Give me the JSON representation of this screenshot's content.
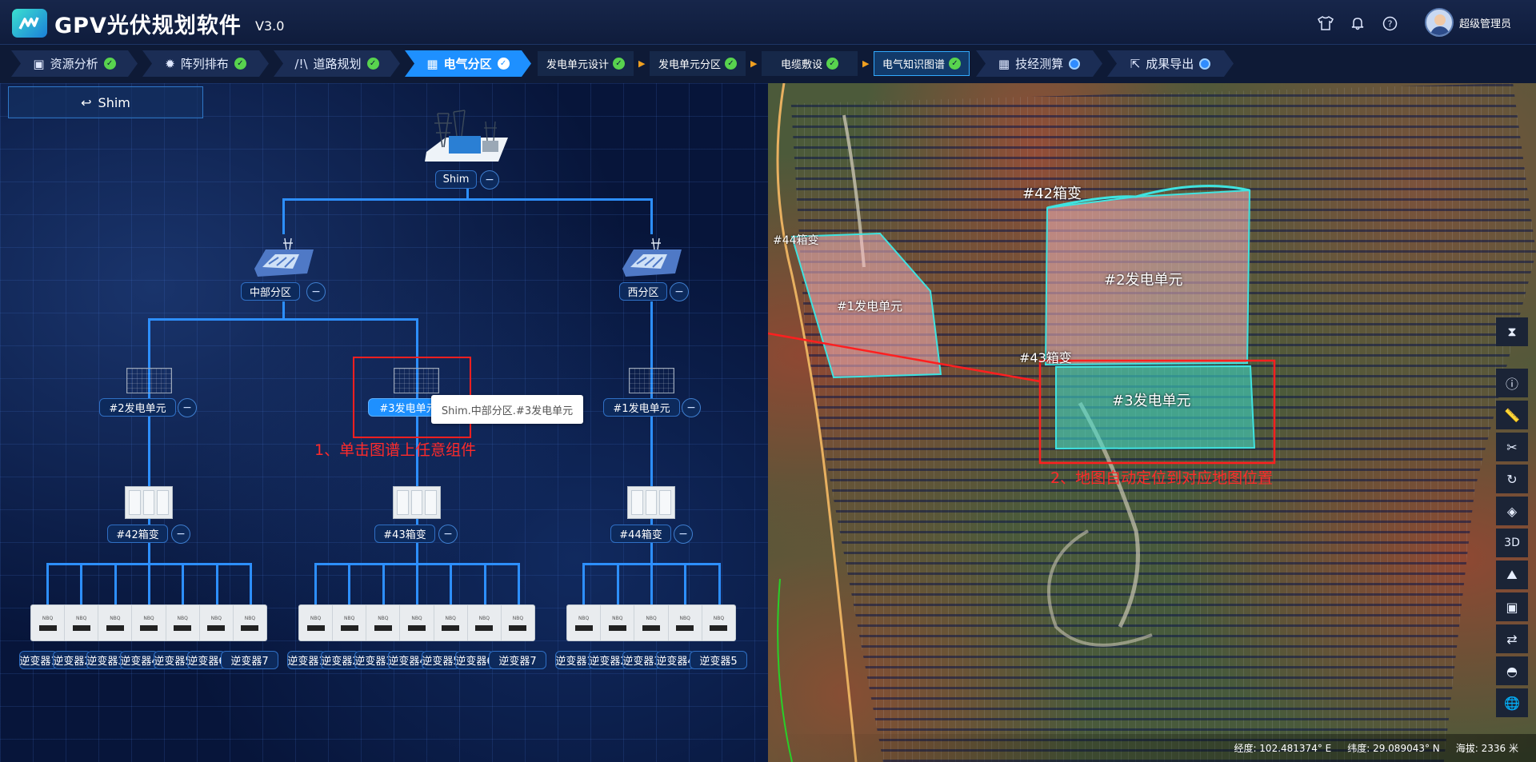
{
  "app": {
    "title": "GPV光伏规划软件",
    "version": "V3.0"
  },
  "header": {
    "user_name": "超级管理员",
    "icons": [
      "shirt-icon",
      "bell-icon",
      "help-icon"
    ]
  },
  "steps": [
    {
      "label": "资源分析",
      "status": "done",
      "icon": "resource-icon"
    },
    {
      "label": "阵列排布",
      "status": "done",
      "icon": "array-icon"
    },
    {
      "label": "道路规划",
      "status": "done",
      "icon": "road-icon"
    },
    {
      "label": "电气分区",
      "status": "active",
      "icon": "electric-icon"
    },
    {
      "label": "发电单元设计",
      "status": "done"
    },
    {
      "label": "发电单元分区",
      "status": "done"
    },
    {
      "label": "电缆敷设",
      "status": "done"
    },
    {
      "label": "电气知识图谱",
      "status": "current"
    },
    {
      "label": "技经测算",
      "status": "pending",
      "icon": "calc-icon"
    },
    {
      "label": "成果导出",
      "status": "pending",
      "icon": "export-icon"
    }
  ],
  "graph": {
    "back_button": "Shim",
    "root": "Shim",
    "zones": [
      "中部分区",
      "西分区"
    ],
    "units": [
      "#2发电单元",
      "#3发电单元",
      "#1发电单元"
    ],
    "boxes": [
      "#42箱变",
      "#43箱变",
      "#44箱变"
    ],
    "inverter_groups": [
      [
        "逆变器1",
        "逆变器2",
        "逆变器3",
        "逆变器4",
        "逆变器5",
        "逆变器6",
        "逆变器7"
      ],
      [
        "逆变器1",
        "逆变器2",
        "逆变器3",
        "逆变器4",
        "逆变器5",
        "逆变器6",
        "逆变器7"
      ],
      [
        "逆变器1",
        "逆变器2",
        "逆变器3",
        "逆变器4",
        "逆变器5"
      ]
    ],
    "tooltip": "Shim.中部分区.#3发电单元",
    "collapse_symbol": "−"
  },
  "annotations": {
    "step1": "1、单击图谱上任意组件",
    "step2": "2、地图自动定位到对应地图位置"
  },
  "map": {
    "labels": [
      "#42箱变",
      "#44箱变",
      "#43箱变",
      "#2发电单元",
      "#1发电单元",
      "#3发电单元"
    ],
    "tools": [
      "3D"
    ],
    "status": {
      "lon": "经度: 102.481374° E",
      "lat": "纬度: 29.089043° N",
      "alt": "海拔: 2336 米"
    }
  },
  "colors": {
    "accent": "#1e90ff",
    "done": "#58d34e",
    "pending": "#2f8cff",
    "annotation": "#ff1f1f",
    "highlight": "#40e0d0"
  }
}
